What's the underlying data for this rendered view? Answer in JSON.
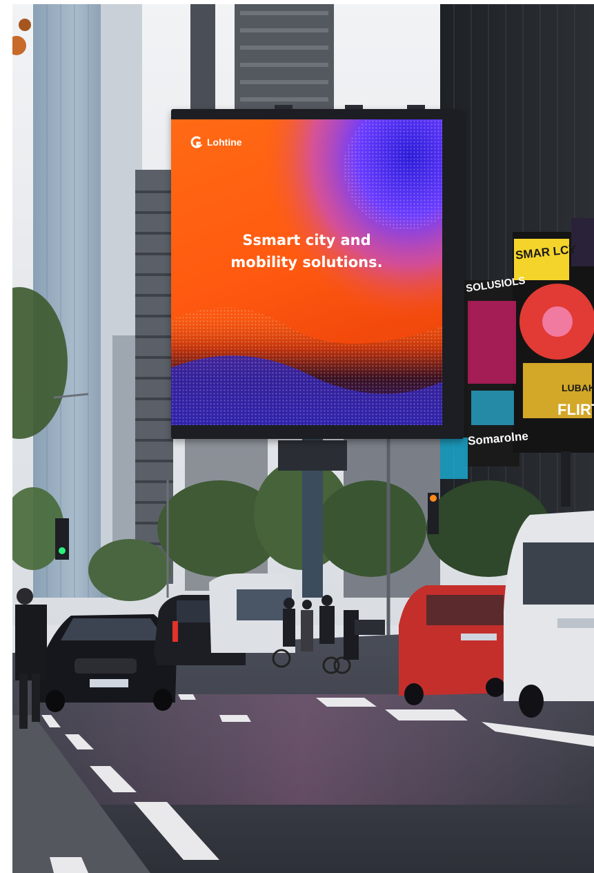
{
  "billboard": {
    "brand": "Lohtine",
    "headline_line1": "Ssmart city and",
    "headline_line2": "mobility solutions."
  },
  "side_signs": {
    "sign1": "SOLUSIOLS",
    "sign2": "SMAR LCY",
    "sign3": "LUBAK",
    "sign4": "FLIRT",
    "sign5": "Somarolne"
  },
  "colors": {
    "billboard_orange": "#ff5a10",
    "billboard_purple": "#6a3cff",
    "sign_yellow": "#f4d42a",
    "sign_magenta": "#e0206e"
  },
  "icons": {
    "brand_logo": "c-shaped-logo-icon",
    "traffic_light_left": "traffic-light-icon",
    "traffic_light_right": "traffic-light-icon"
  }
}
